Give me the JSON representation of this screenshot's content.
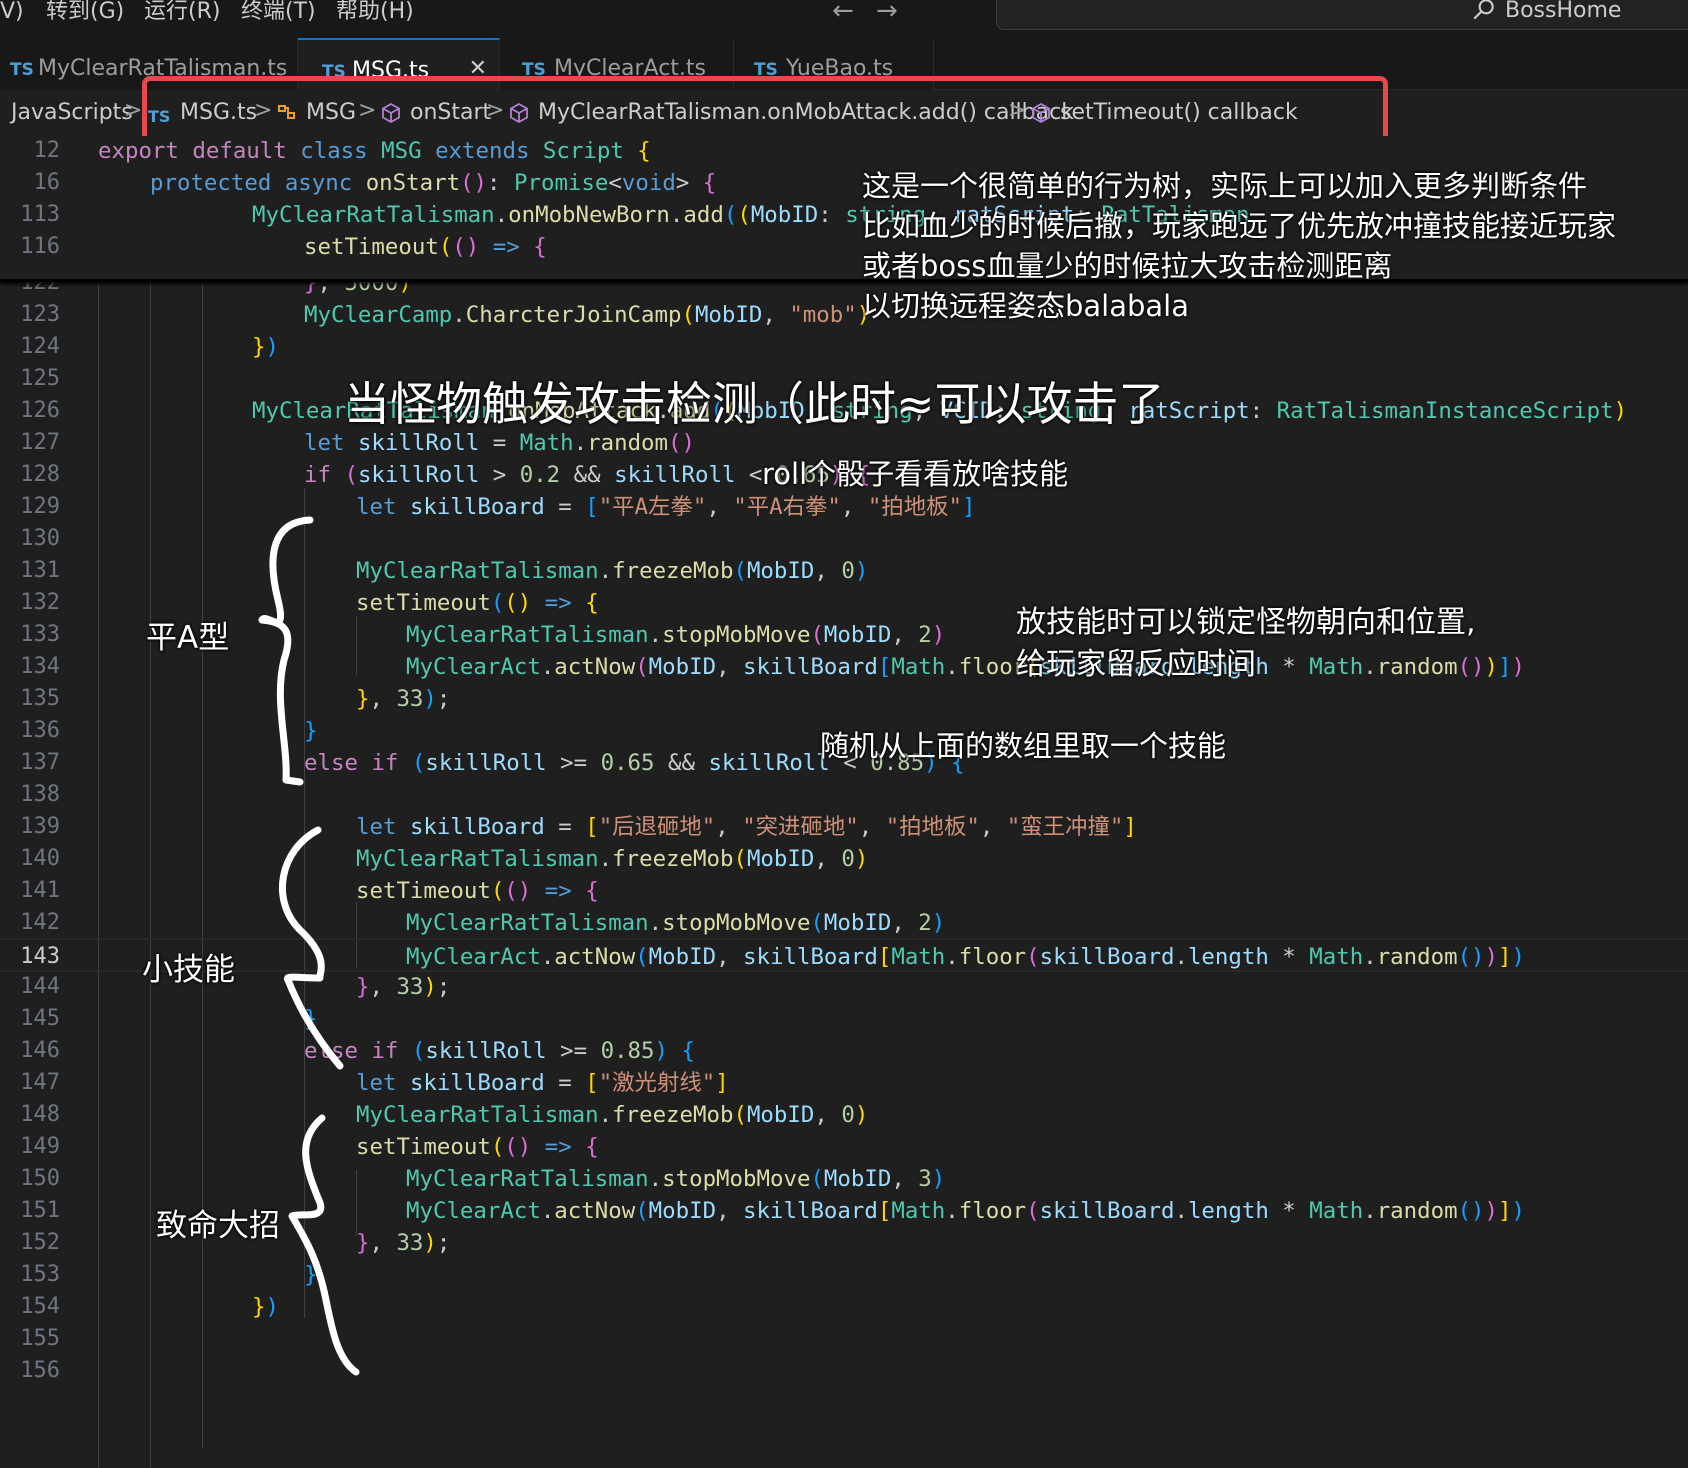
{
  "menubar": {
    "items": [
      "V)",
      "转到(G)",
      "运行(R)",
      "终端(T)",
      "帮助(H)"
    ],
    "back_arrow": "←",
    "forward_arrow": "→",
    "command_center": "BossHome"
  },
  "tabs": [
    {
      "badge": "TS",
      "label": "MyClearRatTalisman.ts",
      "active": false
    },
    {
      "badge": "TS",
      "label": "MSG.ts",
      "active": true,
      "close": "✕"
    },
    {
      "badge": "TS",
      "label": "MyClearAct.ts",
      "active": false
    },
    {
      "badge": "TS",
      "label": "YueBao.ts",
      "active": false
    }
  ],
  "breadcrumb": {
    "root": "JavaScripts",
    "file_badge": "TS",
    "file": "MSG.ts",
    "class": "MSG",
    "method": "onStart",
    "callback1": "MyClearRatTalisman.onMobAttack.add() callback",
    "callback2": "setTimeout() callback",
    "separator": ">"
  },
  "sticky_lines": [
    {
      "n": "12",
      "text": "export default class MSG extends Script {"
    },
    {
      "n": "16",
      "text": "protected async onStart(): Promise<void> {"
    },
    {
      "n": "113",
      "text": "MyClearRatTalisman.onMobNewBorn.add((MobID: string, ratScript: RatTalisman"
    },
    {
      "n": "116",
      "text": "setTimeout(() => {"
    }
  ],
  "lines": [
    {
      "n": "122",
      "text": "}, 5000)"
    },
    {
      "n": "123",
      "text": "MyClearCamp.CharcterJoinCamp(MobID, \"mob\")"
    },
    {
      "n": "124",
      "text": "})"
    },
    {
      "n": "125",
      "text": ""
    },
    {
      "n": "126",
      "text": "MyClearRatTalisman.onMobAttack.add((MobID: string, VCID: string, ratScript: RatTalismanInstanceScript) =>"
    },
    {
      "n": "127",
      "text": "let skillRoll = Math.random()"
    },
    {
      "n": "128",
      "text": "if (skillRoll > 0.2 && skillRoll < 0.65) {"
    },
    {
      "n": "129",
      "text": "let skillBoard = [\"平A左拳\", \"平A右拳\", \"拍地板\"]"
    },
    {
      "n": "130",
      "text": ""
    },
    {
      "n": "131",
      "text": "MyClearRatTalisman.freezeMob(MobID, 0)"
    },
    {
      "n": "132",
      "text": "setTimeout(() => {"
    },
    {
      "n": "133",
      "text": "MyClearRatTalisman.stopMobMove(MobID, 2)"
    },
    {
      "n": "134",
      "text": "MyClearAct.actNow(MobID, skillBoard[Math.floor(skillBoard.length * Math.random())])"
    },
    {
      "n": "135",
      "text": "}, 33);"
    },
    {
      "n": "136",
      "text": "}"
    },
    {
      "n": "137",
      "text": "else if (skillRoll >= 0.65 && skillRoll < 0.85) {"
    },
    {
      "n": "138",
      "text": ""
    },
    {
      "n": "139",
      "text": "let skillBoard = [\"后退砸地\", \"突进砸地\", \"拍地板\", \"蛮王冲撞\"]"
    },
    {
      "n": "140",
      "text": "MyClearRatTalisman.freezeMob(MobID, 0)"
    },
    {
      "n": "141",
      "text": "setTimeout(() => {"
    },
    {
      "n": "142",
      "text": "MyClearRatTalisman.stopMobMove(MobID, 2)"
    },
    {
      "n": "143",
      "text": "MyClearAct.actNow(MobID, skillBoard[Math.floor(skillBoard.length * Math.random())])"
    },
    {
      "n": "144",
      "text": "}, 33);"
    },
    {
      "n": "145",
      "text": "}"
    },
    {
      "n": "146",
      "text": "else if (skillRoll >= 0.85) {"
    },
    {
      "n": "147",
      "text": "let skillBoard = [\"激光射线\"]"
    },
    {
      "n": "148",
      "text": "MyClearRatTalisman.freezeMob(MobID, 0)"
    },
    {
      "n": "149",
      "text": "setTimeout(() => {"
    },
    {
      "n": "150",
      "text": "MyClearRatTalisman.stopMobMove(MobID, 3)"
    },
    {
      "n": "151",
      "text": "MyClearAct.actNow(MobID, skillBoard[Math.floor(skillBoard.length * Math.random())])"
    },
    {
      "n": "152",
      "text": "}, 33);"
    },
    {
      "n": "153",
      "text": "}"
    },
    {
      "n": "154",
      "text": "})"
    },
    {
      "n": "155",
      "text": ""
    },
    {
      "n": "156",
      "text": ""
    }
  ],
  "current_line": "143",
  "annotations": {
    "top_note": [
      "这是一个很简单的行为树，实际上可以加入更多判断条件",
      "比如血少的时候后撤，玩家跑远了优先放冲撞技能接近玩家",
      "或者boss血量少的时候拉大攻击检测距离",
      " 以切换远程姿态balabala"
    ],
    "attack_trigger": "当怪物触发攻击检测（此时≈可以攻击了",
    "roll_note": "roll个骰子看看放啥技能",
    "lock_note": [
      "放技能时可以锁定怪物朝向和位置,",
      "给玩家留反应时间"
    ],
    "random_note": "随机从上面的数组里取一个技能",
    "label_normal": "平A型",
    "label_small": "小技能",
    "label_ult": "致命大招"
  },
  "colors": {
    "highlight_box": "#e5484d",
    "annotation_text": "#ffffff",
    "editor_bg": "#1f1f1f"
  }
}
